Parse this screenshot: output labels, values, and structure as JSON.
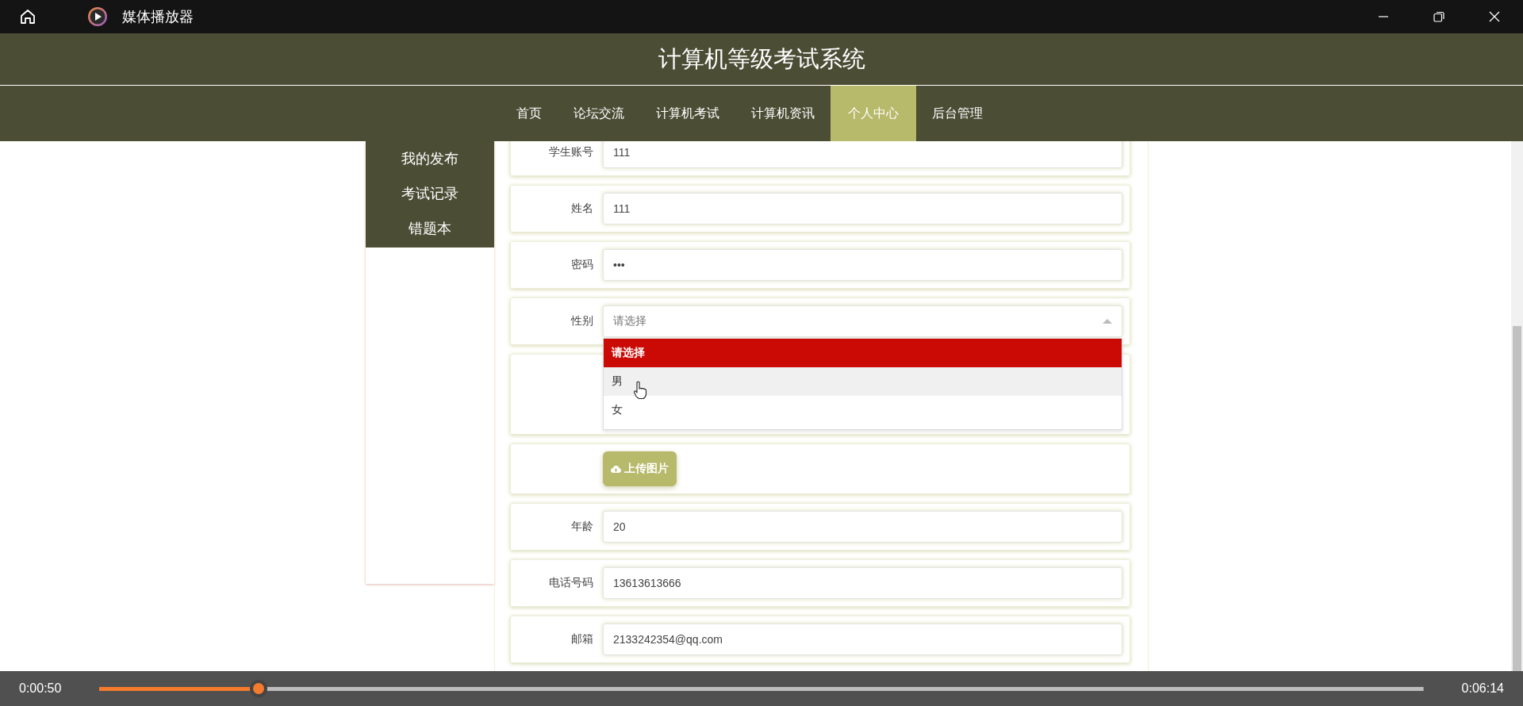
{
  "window": {
    "title": "媒体播放器"
  },
  "site": {
    "title": "计算机等级考试系统",
    "nav": [
      {
        "label": "首页",
        "selected": false
      },
      {
        "label": "论坛交流",
        "selected": false
      },
      {
        "label": "计算机考试",
        "selected": false
      },
      {
        "label": "计算机资讯",
        "selected": false
      },
      {
        "label": "个人中心",
        "selected": true
      },
      {
        "label": "后台管理",
        "selected": false
      }
    ]
  },
  "sidebar": {
    "items": [
      "我的发布",
      "考试记录",
      "错题本"
    ]
  },
  "form": {
    "fields": [
      {
        "kind": "text",
        "label": "学生账号",
        "value": "111"
      },
      {
        "kind": "text",
        "label": "姓名",
        "value": "111"
      },
      {
        "kind": "text",
        "label": "密码",
        "value": "•••"
      },
      {
        "kind": "select",
        "label": "性别",
        "placeholder": "请选择",
        "expanded": true,
        "options": [
          {
            "label": "请选择",
            "selected": true,
            "hovered": false
          },
          {
            "label": "男",
            "selected": false,
            "hovered": true
          },
          {
            "label": "女",
            "selected": false,
            "hovered": false
          }
        ]
      },
      {
        "kind": "image"
      },
      {
        "kind": "upload",
        "button": "上传图片"
      },
      {
        "kind": "text",
        "label": "年龄",
        "value": "20"
      },
      {
        "kind": "text",
        "label": "电话号码",
        "value": "13613613666"
      },
      {
        "kind": "text",
        "label": "邮箱",
        "value": "2133242354@qq.com"
      }
    ]
  },
  "player": {
    "elapsed": "0:00:50",
    "total": "0:06:14",
    "level": 0.12
  }
}
